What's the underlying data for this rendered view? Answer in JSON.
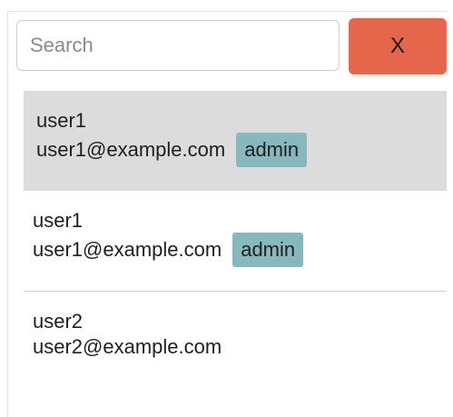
{
  "search": {
    "placeholder": "Search",
    "value": ""
  },
  "clear_button": {
    "label": "X"
  },
  "users": [
    {
      "name": "user1",
      "email": "user1@example.com",
      "role": "admin",
      "selected": true
    },
    {
      "name": "user1",
      "email": "user1@example.com",
      "role": "admin",
      "selected": false
    },
    {
      "name": "user2",
      "email": "user2@example.com",
      "role": "",
      "selected": false
    }
  ],
  "colors": {
    "clear_button_bg": "#e5664a",
    "role_badge_bg": "#86b8be",
    "selected_row_bg": "#dcdcdc"
  }
}
